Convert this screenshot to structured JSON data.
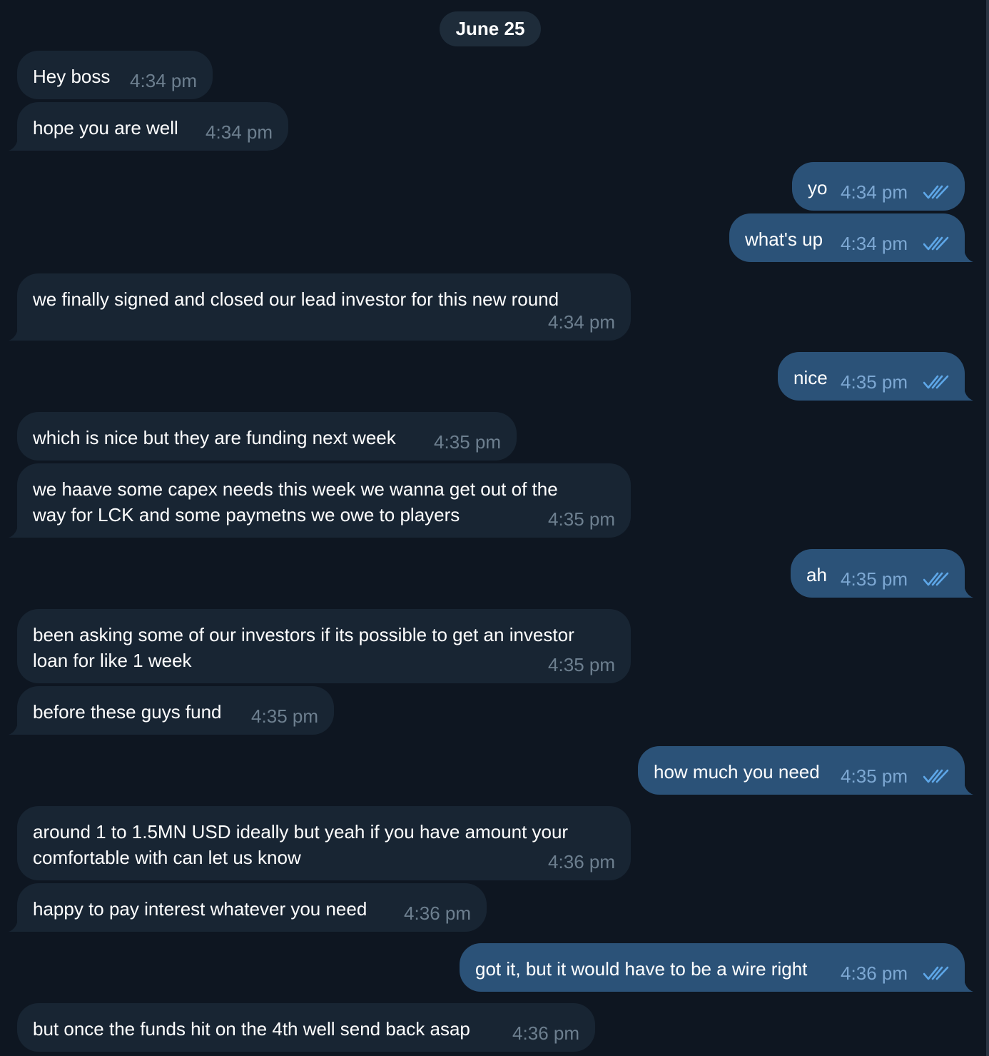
{
  "date_label": "June 25",
  "colors": {
    "background": "#0e1621",
    "incoming_bubble": "#182533",
    "outgoing_bubble": "#2b5278",
    "time_incoming": "#6d7f8f",
    "time_outgoing": "#7da8d3",
    "read_check": "#5ea7e8"
  },
  "messages": [
    {
      "direction": "in",
      "text": "Hey boss",
      "time": "4:34 pm"
    },
    {
      "direction": "in",
      "text": "hope you are well",
      "time": "4:34 pm"
    },
    {
      "direction": "out",
      "text": "yo",
      "time": "4:34 pm",
      "status": "read"
    },
    {
      "direction": "out",
      "text": "what's up",
      "time": "4:34 pm",
      "status": "read"
    },
    {
      "direction": "in",
      "text": "we finally signed and closed our lead investor for this new round",
      "time": "4:34 pm"
    },
    {
      "direction": "out",
      "text": "nice",
      "time": "4:35 pm",
      "status": "read"
    },
    {
      "direction": "in",
      "text": "which is nice but they are funding next week",
      "time": "4:35 pm"
    },
    {
      "direction": "in",
      "text": "we haave some capex needs this week we wanna get out of the\nway for LCK and some paymetns we owe to players",
      "time": "4:35 pm"
    },
    {
      "direction": "out",
      "text": "ah",
      "time": "4:35 pm",
      "status": "read"
    },
    {
      "direction": "in",
      "text": "been asking some of our investors if its possible to get an investor\nloan for like 1 week",
      "time": "4:35 pm"
    },
    {
      "direction": "in",
      "text": "before these guys fund",
      "time": "4:35 pm"
    },
    {
      "direction": "out",
      "text": "how much you need",
      "time": "4:35 pm",
      "status": "read"
    },
    {
      "direction": "in",
      "text": "around 1 to 1.5MN USD ideally but yeah if you have amount your\ncomfortable with can let us know",
      "time": "4:36 pm"
    },
    {
      "direction": "in",
      "text": "happy to pay interest whatever you need",
      "time": "4:36 pm"
    },
    {
      "direction": "out",
      "text": "got it, but it would have to be a wire right",
      "time": "4:36 pm",
      "status": "read"
    },
    {
      "direction": "in",
      "text": "but once the funds hit on the 4th well send back asap",
      "time": "4:36 pm"
    }
  ]
}
